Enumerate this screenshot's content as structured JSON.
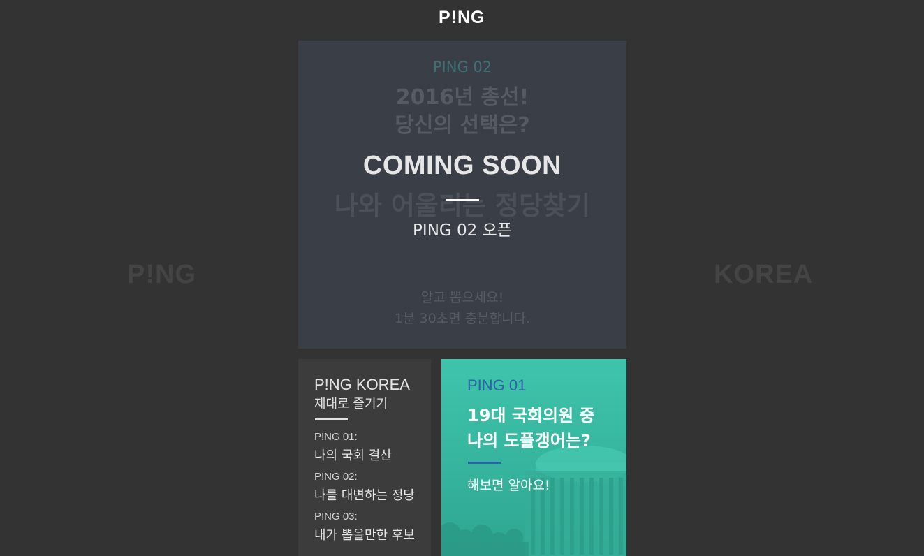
{
  "header": {
    "logo": "P!NG"
  },
  "background": {
    "left_word": "P!NG",
    "right_word": "KOREA"
  },
  "ping02_card": {
    "eyebrow": "PING 02",
    "dim_title_line1": "2016년 총선!",
    "dim_title_line2": "당신의 선택은?",
    "coming_soon": "COMING SOON",
    "dim_big": "나와 어울리는 정당찾기",
    "open_label": "PING 02 오픈",
    "dim_sub_line1": "알고 뽑으세요!",
    "dim_sub_line2": "1분 30초면 충분합니다."
  },
  "korea_card": {
    "title": "P!NG KOREA",
    "subtitle": "제대로 즐기기",
    "items": [
      {
        "label": "P!NG 01:",
        "value": "나의 국회 결산"
      },
      {
        "label": "P!NG 02:",
        "value": "나를 대변하는 정당"
      },
      {
        "label": "P!NG 03:",
        "value": "내가 뽑을만한 후보"
      }
    ]
  },
  "ping01_card": {
    "eyebrow": "PING 01",
    "title_line1": "19대 국회의원 중",
    "title_line2": "나의 도플갱어는?",
    "subtitle": "해보면 알아요!"
  },
  "colors": {
    "background": "#333333",
    "ping01_teal": "#3fc4ab",
    "accent_blue": "#2c63a8",
    "ping02_card": "#3a3e47"
  }
}
